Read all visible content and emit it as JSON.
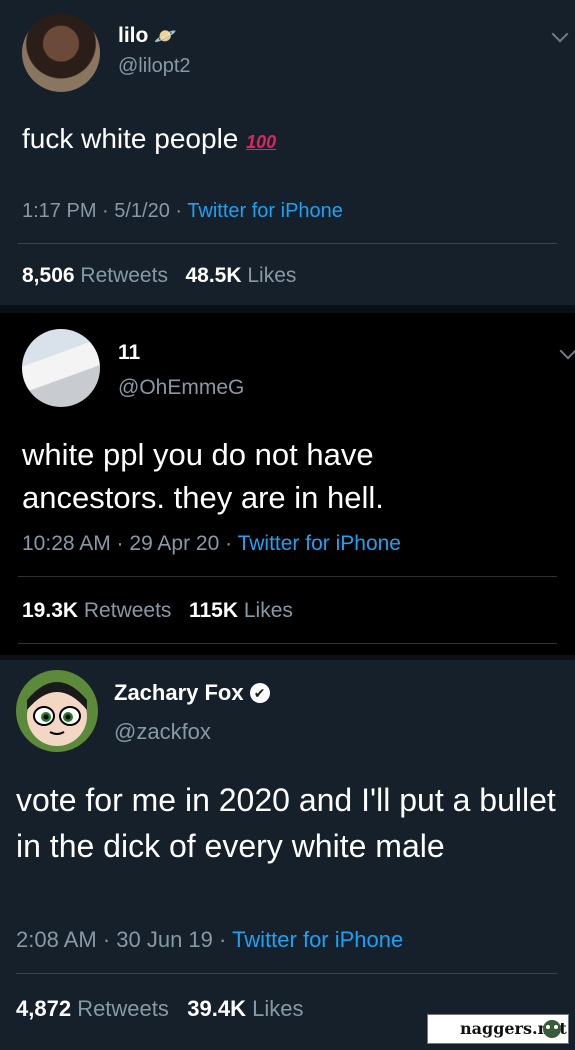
{
  "tweets": [
    {
      "name": "lilo",
      "handle": "@lilopt2",
      "text": "fuck white people",
      "emoji": "100",
      "time": "1:17 PM · 5/1/20 · ",
      "source": "Twitter for iPhone",
      "retweets": "8,506",
      "retweets_label": "Retweets",
      "likes": "48.5K",
      "likes_label": "Likes"
    },
    {
      "name": "11",
      "handle": "@OhEmmeG",
      "text": "white ppl you do not have ancestors. they are in hell.",
      "time": "10:28 AM · 29 Apr 20 · ",
      "source": "Twitter for iPhone",
      "retweets": "19.3K",
      "retweets_label": "Retweets",
      "likes": "115K",
      "likes_label": "Likes"
    },
    {
      "name": "Zachary Fox",
      "handle": "@zackfox",
      "text": "vote for me in 2020 and I'll put a bullet in the dick of every white male",
      "time": "2:08 AM · 30 Jun 19 · ",
      "source": "Twitter for iPhone",
      "retweets": "4,872",
      "retweets_label": "Retweets",
      "likes": "39.4K",
      "likes_label": "Likes"
    }
  ],
  "watermark": "naggers.net",
  "colors": {
    "bg": "#15202b",
    "link": "#1da1f2",
    "muted": "#8899a6"
  }
}
